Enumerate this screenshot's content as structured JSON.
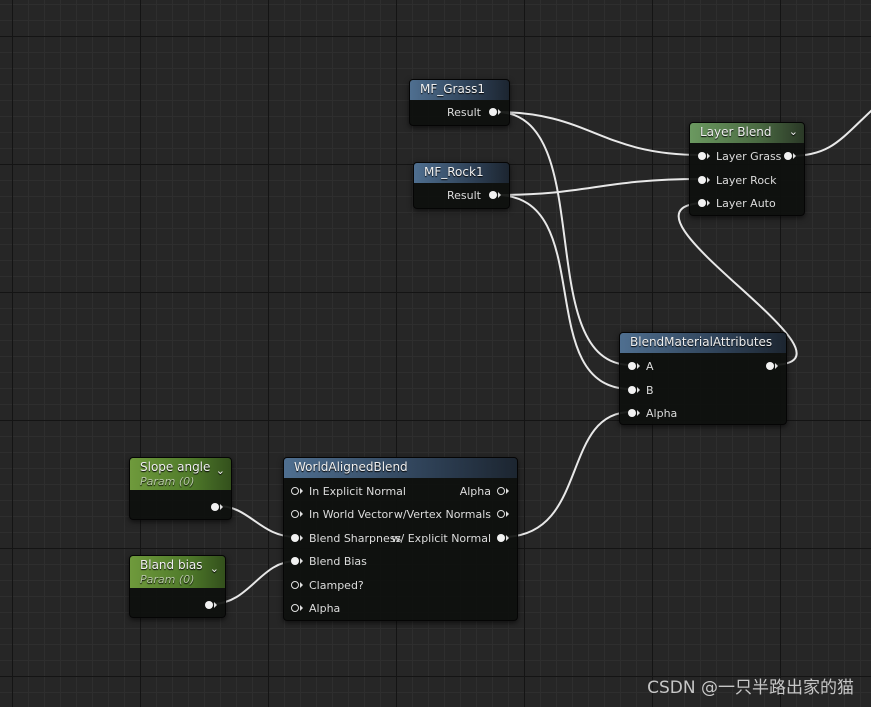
{
  "colors": {
    "background": "#262626",
    "wire": "#e8e8e8",
    "header_function": "#4f6f90",
    "header_layer": "#6b9960",
    "header_param": "#6f9a3c"
  },
  "nodes": {
    "mf_grass1": {
      "title": "MF_Grass1",
      "output": "Result"
    },
    "mf_rock1": {
      "title": "MF_Rock1",
      "output": "Result"
    },
    "layer_blend": {
      "title": "Layer Blend",
      "inputs": [
        "Layer Grass",
        "Layer Rock",
        "Layer Auto"
      ]
    },
    "blend_material_attributes": {
      "title": "BlendMaterialAttributes",
      "inputs": [
        "A",
        "B",
        "Alpha"
      ]
    },
    "world_aligned_blend": {
      "title": "WorldAlignedBlend",
      "inputs": [
        "In Explicit Normal",
        "In World Vector",
        "Blend Sharpness",
        "Blend Bias",
        "Clamped?",
        "Alpha"
      ],
      "outputs": [
        "Alpha",
        "w/Vertex Normals",
        "w/ Explicit Normal"
      ]
    },
    "slope_angle": {
      "title": "Slope angle",
      "subtitle": "Param (0)"
    },
    "bland_bias": {
      "title": "Bland bias",
      "subtitle": "Param (0)"
    }
  },
  "watermark": "CSDN @一只半路出家的猫"
}
